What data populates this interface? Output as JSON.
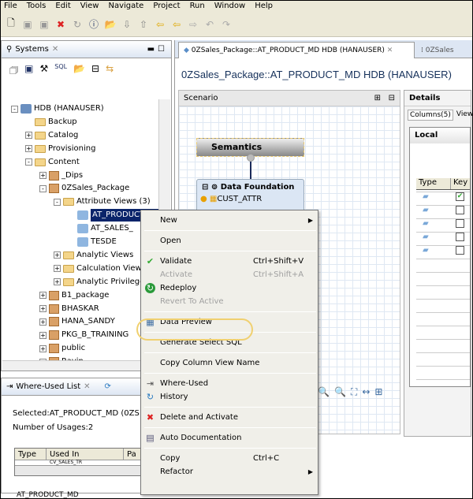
{
  "menubar": [
    "File",
    "Tools",
    "Edit",
    "View",
    "Navigate",
    "Project",
    "Run",
    "Window",
    "Help"
  ],
  "systems": {
    "tab": "Systems",
    "tree": [
      {
        "label": "HDB (HANAUSER)",
        "level": 0,
        "exp": "-",
        "icon": "system"
      },
      {
        "label": "Backup",
        "level": 1,
        "exp": "",
        "icon": "backup"
      },
      {
        "label": "Catalog",
        "level": 1,
        "exp": "+",
        "icon": "folder"
      },
      {
        "label": "Provisioning",
        "level": 1,
        "exp": "+",
        "icon": "folder"
      },
      {
        "label": "Content",
        "level": 1,
        "exp": "-",
        "icon": "folder"
      },
      {
        "label": "_Dips",
        "level": 2,
        "exp": "+",
        "icon": "package"
      },
      {
        "label": "0ZSales_Package",
        "level": 2,
        "exp": "-",
        "icon": "package"
      },
      {
        "label": "Attribute Views (3)",
        "level": 3,
        "exp": "-",
        "icon": "folder"
      },
      {
        "label": "AT_PRODUCT_MD",
        "level": 4,
        "exp": "",
        "icon": "view",
        "selected": true
      },
      {
        "label": "AT_SALES_",
        "level": 4,
        "exp": "",
        "icon": "view"
      },
      {
        "label": "TESDE",
        "level": 4,
        "exp": "",
        "icon": "view"
      },
      {
        "label": "Analytic Views",
        "level": 3,
        "exp": "+",
        "icon": "folder"
      },
      {
        "label": "Calculation Views",
        "level": 3,
        "exp": "+",
        "icon": "folder"
      },
      {
        "label": "Analytic Privileges",
        "level": 3,
        "exp": "+",
        "icon": "folder"
      },
      {
        "label": "B1_package",
        "level": 2,
        "exp": "+",
        "icon": "package"
      },
      {
        "label": "BHASKAR",
        "level": 2,
        "exp": "+",
        "icon": "package"
      },
      {
        "label": "HANA_SANDY",
        "level": 2,
        "exp": "+",
        "icon": "package"
      },
      {
        "label": "PKG_B_TRAINING",
        "level": 2,
        "exp": "+",
        "icon": "package"
      },
      {
        "label": "public",
        "level": 2,
        "exp": "+",
        "icon": "package"
      },
      {
        "label": "Ravin",
        "level": 2,
        "exp": "+",
        "icon": "package"
      }
    ]
  },
  "where_used": {
    "tab": "Where-Used List",
    "selected": "Selected:AT_PRODUCT_MD  (0ZS",
    "usages": "Number of Usages:2",
    "columns": [
      "Type",
      "Used In",
      "Pa"
    ],
    "row": "CV_SALES_TR"
  },
  "status": "AT_PRODUCT_MD",
  "editor": {
    "tab": "0ZSales_Package::AT_PRODUCT_MD HDB (HANAUSER)",
    "tab2": "0ZSales",
    "title": "0ZSales_Package::AT_PRODUCT_MD HDB (HANAUSER)",
    "scenario": "Scenario",
    "semantics": "Semantics",
    "data_foundation": "Data Foundation",
    "table": "CUST_ATTR",
    "details": "Details",
    "details_tabs": [
      "Columns(5)",
      "View"
    ],
    "local": "Local",
    "cols": [
      "Type",
      "Key"
    ],
    "keys": [
      true,
      false,
      false,
      false,
      false
    ]
  },
  "context_menu": [
    {
      "label": "New",
      "submenu": true
    },
    {
      "sep": true
    },
    {
      "label": "Open"
    },
    {
      "sep": true
    },
    {
      "label": "Validate",
      "shortcut": "Ctrl+Shift+V",
      "icon": "check"
    },
    {
      "label": "Activate",
      "shortcut": "Ctrl+Shift+A",
      "disabled": true
    },
    {
      "label": "Redeploy",
      "icon": "redeploy"
    },
    {
      "label": "Revert To Active",
      "disabled": true
    },
    {
      "sep": true
    },
    {
      "label": "Data Preview",
      "icon": "data-preview",
      "highlight": true
    },
    {
      "sep": true
    },
    {
      "label": "Generate Select SQL"
    },
    {
      "sep": true
    },
    {
      "label": "Copy Column View Name"
    },
    {
      "sep": true
    },
    {
      "label": "Where-Used",
      "icon": "where-used"
    },
    {
      "label": "History",
      "icon": "history"
    },
    {
      "sep": true
    },
    {
      "label": "Delete and Activate",
      "icon": "delete"
    },
    {
      "sep": true
    },
    {
      "label": "Auto Documentation",
      "icon": "doc"
    },
    {
      "sep": true
    },
    {
      "label": "Copy",
      "shortcut": "Ctrl+C"
    },
    {
      "label": "Refactor",
      "submenu": true
    }
  ],
  "highlight_color": "#f0d070"
}
